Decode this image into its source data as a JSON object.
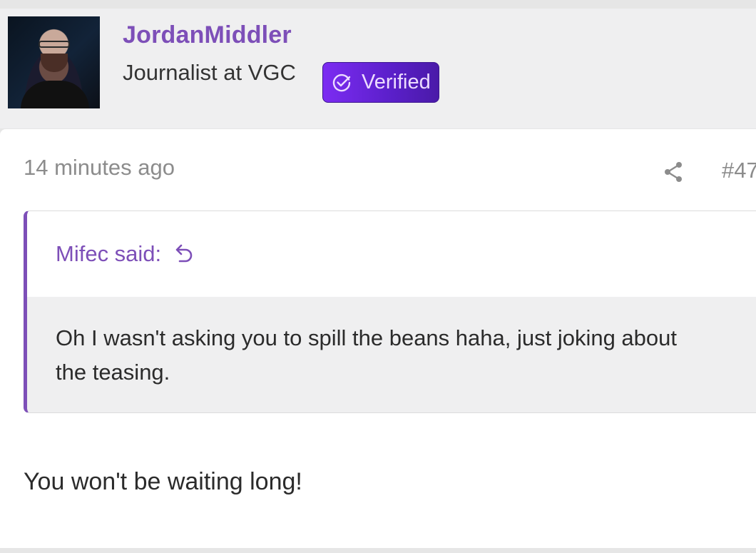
{
  "user": {
    "username": "JordanMiddler",
    "title": "Journalist at VGC",
    "badge_label": "Verified"
  },
  "post": {
    "timestamp": "14 minutes ago",
    "number": "#47",
    "quote": {
      "author": "Mifec said:",
      "text": "Oh I wasn't asking you to spill the beans haha, just joking about the teasing."
    },
    "reply": "You won't be waiting long!"
  },
  "icons": {
    "badge": "check-circle-icon",
    "share": "share-icon",
    "jump": "arrow-return-icon"
  },
  "colors": {
    "accent": "#7d4fb8",
    "badge_bg": "#6a25e0"
  }
}
